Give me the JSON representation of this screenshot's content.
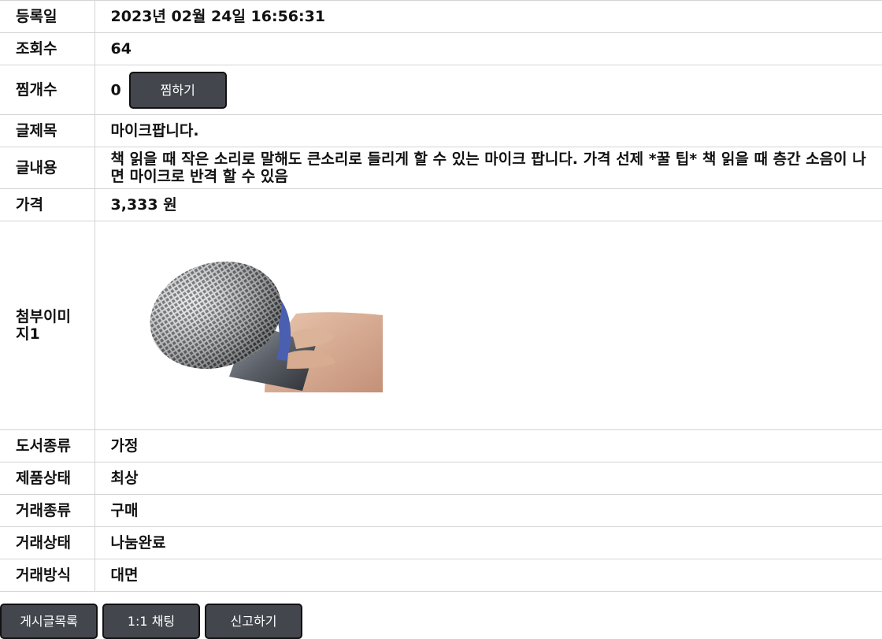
{
  "rows": {
    "registered": {
      "label": "등록일",
      "value": "2023년 02월 24일 16:56:31"
    },
    "views": {
      "label": "조회수",
      "value": "64"
    },
    "likes": {
      "label": "찜개수",
      "value": "0",
      "button": "찜하기"
    },
    "title": {
      "label": "글제목",
      "value": "마이크팝니다."
    },
    "content": {
      "label": "글내용",
      "value": "책 읽을 때 작은 소리로 말해도 큰소리로 들리게 할 수 있는 마이크 팝니다. 가격 선제 *꿀 팁* 책 읽을 때 층간 소음이 나면 마이크로 반격 할 수 있음"
    },
    "price": {
      "label": "가격",
      "value": "3,333 원"
    },
    "image": {
      "label": "첨부이미지1",
      "image_desc": "microphone-photo"
    },
    "book_type": {
      "label": "도서종류",
      "value": "가정"
    },
    "condition": {
      "label": "제품상태",
      "value": "최상"
    },
    "trade_type": {
      "label": "거래종류",
      "value": "구매"
    },
    "trade_status": {
      "label": "거래상태",
      "value": "나눔완료"
    },
    "trade_method": {
      "label": "거래방식",
      "value": "대면"
    }
  },
  "footer": {
    "list": "게시글목록",
    "chat": "1:1 채팅",
    "report": "신고하기"
  },
  "colors": {
    "button_bg": "#43464d",
    "border": "#d4d4d4"
  }
}
